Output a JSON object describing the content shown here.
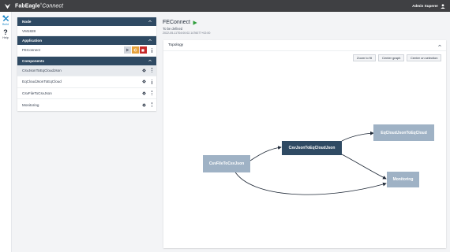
{
  "topbar": {
    "brand_bold": "FabEagle",
    "brand_mark": "®",
    "brand_light": "Connect",
    "user_name": "Admin Superer"
  },
  "rail": {
    "items": [
      {
        "label": "Build",
        "icon": "build-tools-icon",
        "active": true
      },
      {
        "label": "Help",
        "icon": "help-icon",
        "active": false
      }
    ]
  },
  "sidebar": {
    "node_header": "Node",
    "node_value": "VM1828",
    "application_header": "Application",
    "application_name": "FEConnect",
    "components_header": "Components",
    "components": [
      {
        "label": "CsvJsonToEqCloudJson",
        "selected": true
      },
      {
        "label": "EqCloudJsonToEqCloud",
        "selected": false
      },
      {
        "label": "CsvFileToCsvJson",
        "selected": false
      },
      {
        "label": "Monitoring",
        "selected": false
      }
    ]
  },
  "main": {
    "title": "FEConnect",
    "subtitle": "To be defined",
    "date": "2022-05-11T04:00:02.1476077+02:00"
  },
  "topology": {
    "title": "Topology",
    "buttons": {
      "zoom_fit": "Zoom to fit",
      "center_graph": "Center graph",
      "center_selection": "Center on selection"
    },
    "nodes": {
      "csv_json": "CsvJsonToEqCloudJson",
      "eq_cloud": "EqCloudJsonToEqCloud",
      "csv_file": "CsvFileToCsvJson",
      "monitoring": "Monitoring"
    }
  },
  "colors": {
    "topbar": "#3f4043",
    "section_header": "#2f4a63",
    "node_dark": "#2f4a63",
    "node_light": "#9fb2c5",
    "play_green": "#2e9e3a",
    "restart_orange": "#e6a23c",
    "stop_red": "#c62828"
  }
}
